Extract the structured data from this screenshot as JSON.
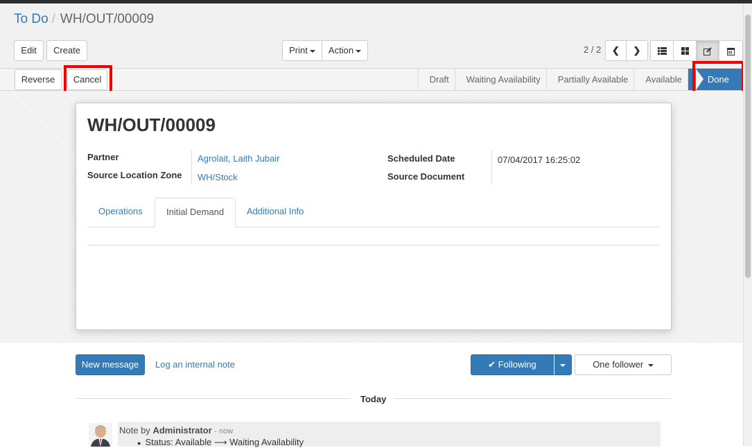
{
  "breadcrumb": {
    "parent": "To Do",
    "separator": "/",
    "current": "WH/OUT/00009"
  },
  "toolbar": {
    "edit": "Edit",
    "create": "Create",
    "print": "Print",
    "action": "Action"
  },
  "pager": {
    "value": "2 / 2"
  },
  "view_switcher": {
    "icons": [
      "list-icon",
      "kanban-icon",
      "form-icon",
      "calendar-icon"
    ],
    "active": "form-icon"
  },
  "statusbar": {
    "reverse": "Reverse",
    "cancel": "Cancel",
    "states": [
      "Draft",
      "Waiting Availability",
      "Partially Available",
      "Available",
      "Done"
    ],
    "active_state": "Done"
  },
  "highlight_color": "#ee0000",
  "accent_color": "#337ab7",
  "record": {
    "title": "WH/OUT/00009",
    "partner_label": "Partner",
    "partner_value": "Agrolait, Laith Jubair",
    "source_location_label": "Source Location Zone",
    "source_location_value": "WH/Stock",
    "scheduled_date_label": "Scheduled Date",
    "scheduled_date_value": "07/04/2017 16:25:02",
    "source_document_label": "Source Document"
  },
  "tabs": [
    "Operations",
    "Initial Demand",
    "Additional Info"
  ],
  "active_tab": "Initial Demand",
  "chatter": {
    "new_message": "New message",
    "log_note": "Log an internal note",
    "following": "Following",
    "followers": "One follower",
    "date_separator": "Today",
    "message": {
      "prefix": "Note by",
      "author": "Administrator",
      "time": "- now",
      "body": "Status: Available",
      "arrow": "⟶",
      "body_new": "Waiting Availability"
    }
  }
}
